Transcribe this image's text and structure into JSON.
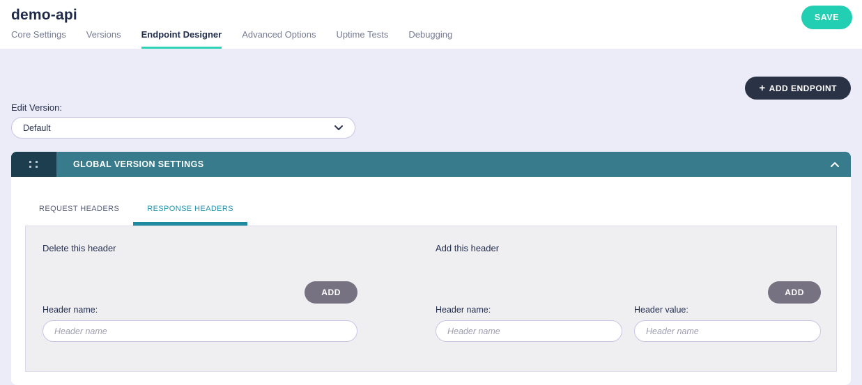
{
  "header": {
    "title": "demo-api",
    "save_label": "SAVE",
    "tabs": [
      "Core Settings",
      "Versions",
      "Endpoint Designer",
      "Advanced Options",
      "Uptime Tests",
      "Debugging"
    ],
    "active_tab": "Endpoint Designer"
  },
  "toolbar": {
    "add_endpoint_label": "ADD ENDPOINT",
    "plus_icon": "+"
  },
  "version": {
    "label": "Edit Version:",
    "selected": "Default"
  },
  "card": {
    "title": "GLOBAL VERSION SETTINGS",
    "tabs": [
      "REQUEST HEADERS",
      "RESPONSE HEADERS"
    ],
    "active_tab": "RESPONSE HEADERS"
  },
  "sections": {
    "delete": {
      "title": "Delete this header",
      "add_label": "ADD",
      "fields": [
        {
          "label": "Header name:",
          "placeholder": "Header name"
        }
      ]
    },
    "add": {
      "title": "Add this header",
      "add_label": "ADD",
      "fields": [
        {
          "label": "Header name:",
          "placeholder": "Header name"
        },
        {
          "label": "Header value:",
          "placeholder": "Header name"
        }
      ]
    }
  },
  "colors": {
    "accent_teal": "#22cfb2",
    "bar_teal": "#377b8d",
    "handle_dark": "#1c3e4f",
    "dark_button": "#2a3245",
    "active_subtab_teal": "#1f8a9e",
    "page_background": "#ebecf7",
    "panel_gray": "#efeff2",
    "input_border": "#c7c5e4",
    "add_button_gray": "#767281",
    "text_navy": "#232e4d"
  }
}
